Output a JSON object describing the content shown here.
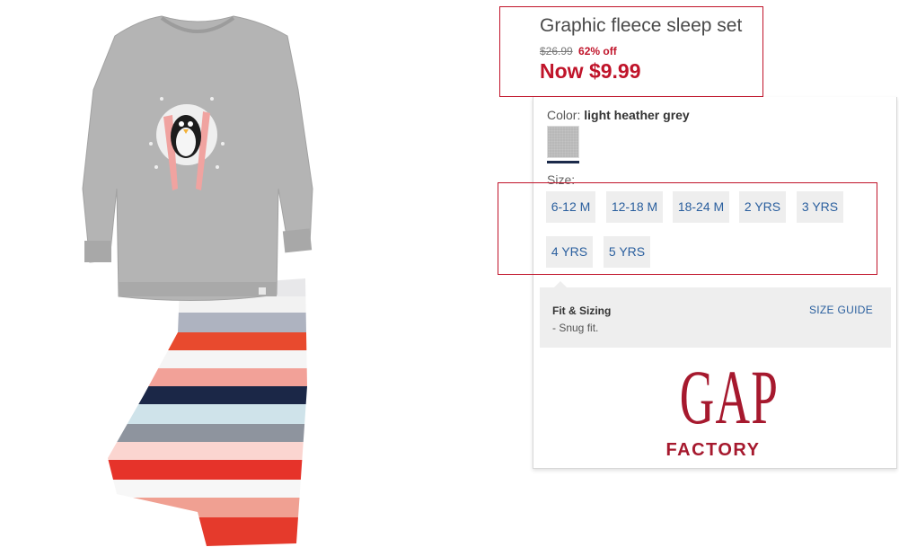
{
  "product": {
    "title": "Graphic fleece sleep set",
    "old_price": "$26.99",
    "discount": "62% off",
    "now_price": "Now $9.99",
    "image_icon": "product-photo-pajama-set-icon"
  },
  "color": {
    "label": "Color:",
    "value": "light heather grey",
    "swatch_color": "#b8b8b8"
  },
  "size": {
    "label": "Size:",
    "options": [
      "6-12 M",
      "12-18 M",
      "18-24 M",
      "2 YRS",
      "3 YRS",
      "4 YRS",
      "5 YRS"
    ]
  },
  "fit": {
    "title": "Fit & Sizing",
    "detail": "- Snug fit.",
    "size_guide": "SIZE GUIDE"
  },
  "brand": {
    "logo_word": "GAP",
    "logo_sub": "FACTORY",
    "color": "#a6192e"
  },
  "colors": {
    "accent_red": "#c0142a",
    "link_blue": "#2a5f9e"
  }
}
